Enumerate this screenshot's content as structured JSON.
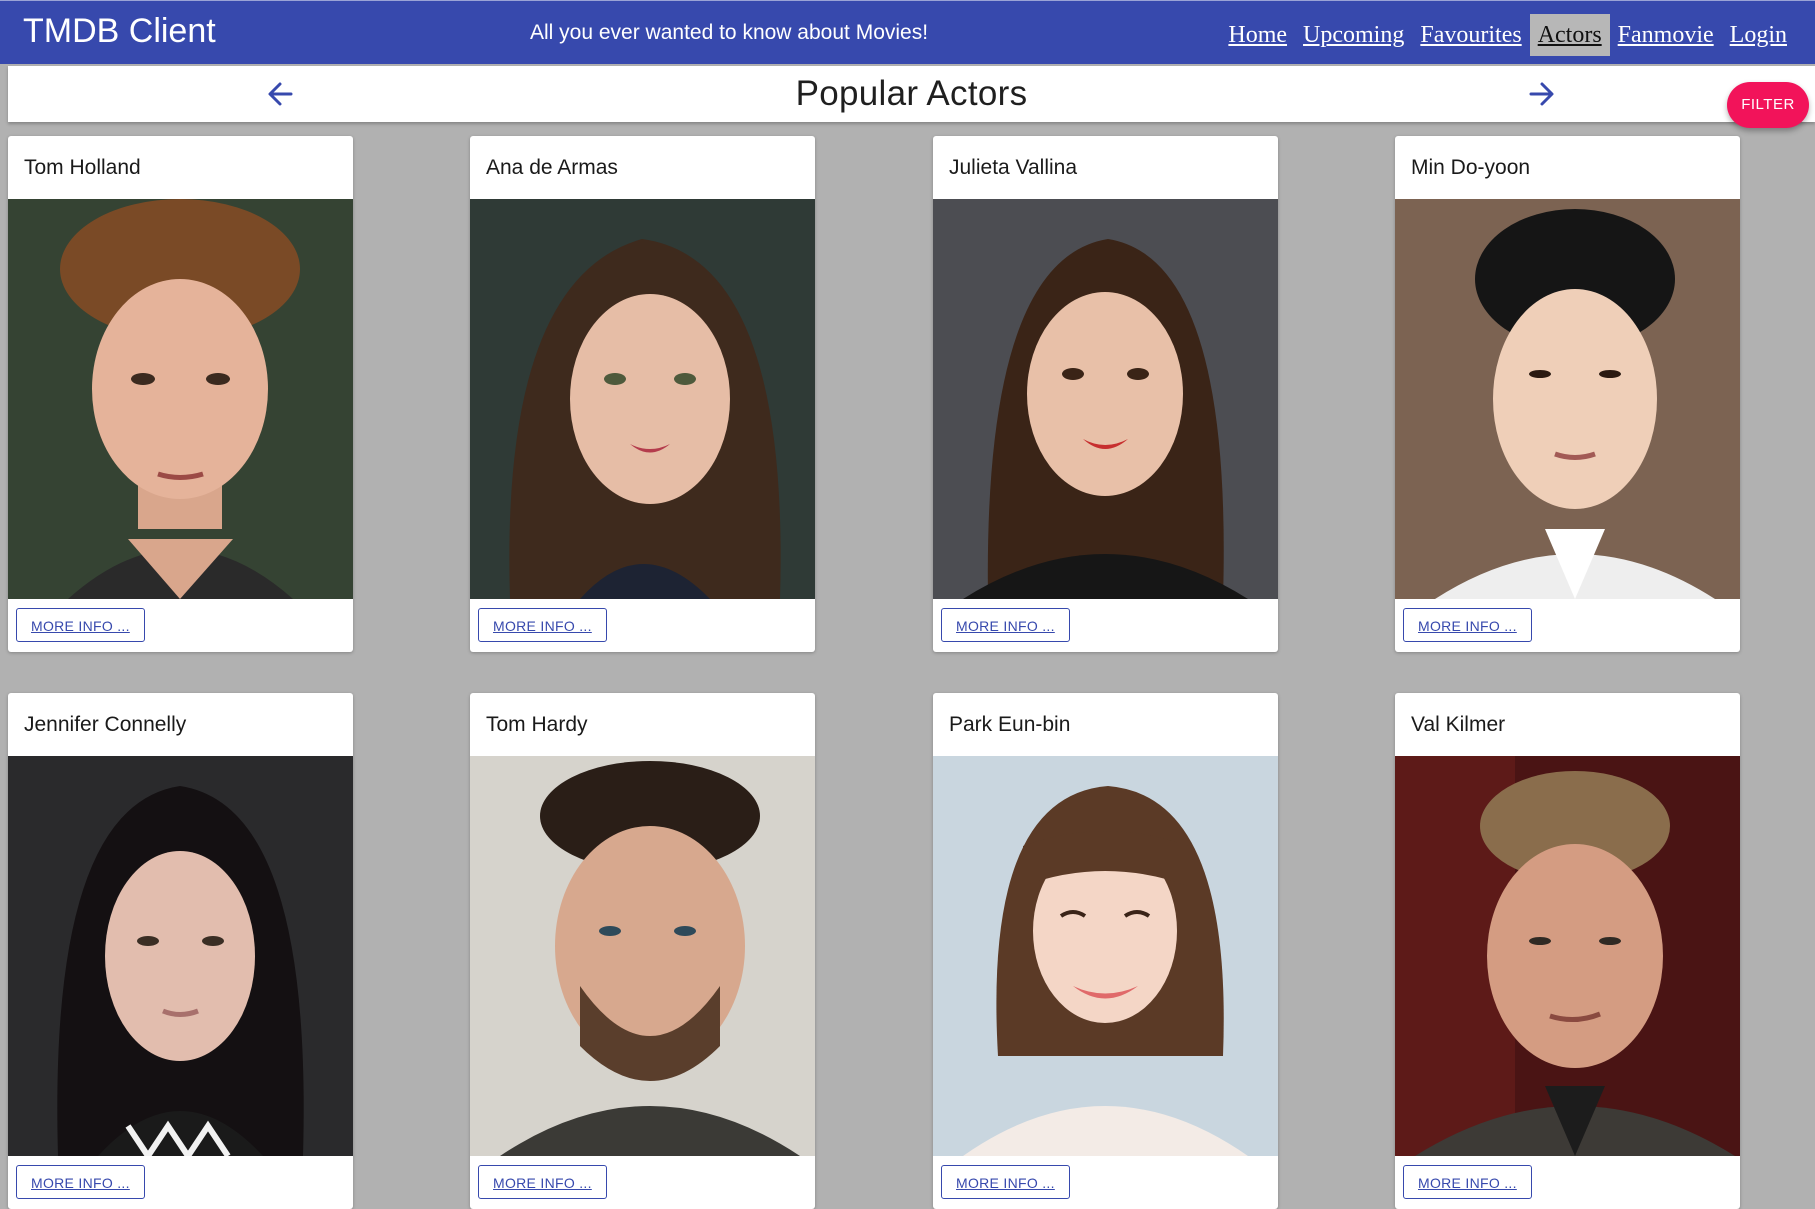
{
  "app": {
    "title": "TMDB Client",
    "tagline": "All you ever wanted to know about Movies!",
    "colors": {
      "appbar": "#3749ad",
      "accent": "#f2135a",
      "background": "#b1b1b1"
    }
  },
  "nav": {
    "items": [
      {
        "label": "Home",
        "active": false
      },
      {
        "label": "Upcoming",
        "active": false
      },
      {
        "label": "Favourites",
        "active": false
      },
      {
        "label": "Actors",
        "active": true
      },
      {
        "label": "Fanmovie",
        "active": false
      },
      {
        "label": "Login",
        "active": false
      }
    ]
  },
  "page": {
    "title": "Popular Actors",
    "prev_icon": "arrow-back-icon",
    "next_icon": "arrow-forward-icon",
    "filter_label": "FILTER"
  },
  "actors": [
    {
      "name": "Tom Holland",
      "more_label": "MORE INFO ..."
    },
    {
      "name": "Ana de Armas",
      "more_label": "MORE INFO ..."
    },
    {
      "name": "Julieta Vallina",
      "more_label": "MORE INFO ..."
    },
    {
      "name": "Min Do-yoon",
      "more_label": "MORE INFO ..."
    },
    {
      "name": "Jennifer Connelly",
      "more_label": "MORE INFO ..."
    },
    {
      "name": "Tom Hardy",
      "more_label": "MORE INFO ..."
    },
    {
      "name": "Park Eun-bin",
      "more_label": "MORE INFO ..."
    },
    {
      "name": "Val Kilmer",
      "more_label": "MORE INFO ..."
    }
  ]
}
